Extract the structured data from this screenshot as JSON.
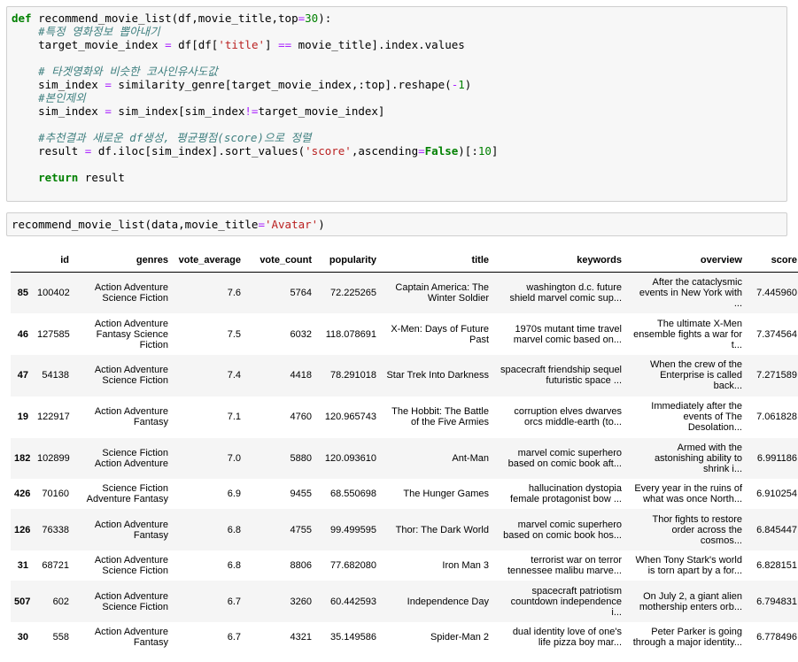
{
  "cell1": {
    "lines": [
      [
        {
          "t": "def",
          "c": "kw"
        },
        {
          "t": " recommend_movie_list(df,movie_title,top"
        },
        {
          "t": "=",
          "c": "op"
        },
        {
          "t": "30",
          "c": "num"
        },
        {
          "t": "):"
        }
      ],
      [
        {
          "t": "    "
        },
        {
          "t": "#특정 영화정보 뽑아내기",
          "c": "cm"
        }
      ],
      [
        {
          "t": "    target_movie_index "
        },
        {
          "t": "=",
          "c": "op"
        },
        {
          "t": " df[df["
        },
        {
          "t": "'title'",
          "c": "str"
        },
        {
          "t": "] "
        },
        {
          "t": "==",
          "c": "op"
        },
        {
          "t": " movie_title].index.values"
        }
      ],
      [
        {
          "t": ""
        }
      ],
      [
        {
          "t": "    "
        },
        {
          "t": "# 타겟영화와 비슷한 코사인유사도값",
          "c": "cm"
        }
      ],
      [
        {
          "t": "    sim_index "
        },
        {
          "t": "=",
          "c": "op"
        },
        {
          "t": " similarity_genre[target_movie_index,:top].reshape("
        },
        {
          "t": "-",
          "c": "op"
        },
        {
          "t": "1",
          "c": "num"
        },
        {
          "t": ")"
        }
      ],
      [
        {
          "t": "    "
        },
        {
          "t": "#본인제외",
          "c": "cm"
        }
      ],
      [
        {
          "t": "    sim_index "
        },
        {
          "t": "=",
          "c": "op"
        },
        {
          "t": " sim_index[sim_index"
        },
        {
          "t": "!=",
          "c": "op"
        },
        {
          "t": "target_movie_index]"
        }
      ],
      [
        {
          "t": ""
        }
      ],
      [
        {
          "t": "    "
        },
        {
          "t": "#추천결과 새로운 df생성, 평균평점(score)으로 정렬",
          "c": "cm"
        }
      ],
      [
        {
          "t": "    result "
        },
        {
          "t": "=",
          "c": "op"
        },
        {
          "t": " df.iloc[sim_index].sort_values("
        },
        {
          "t": "'score'",
          "c": "str"
        },
        {
          "t": ",ascending"
        },
        {
          "t": "=",
          "c": "op"
        },
        {
          "t": "False",
          "c": "kw"
        },
        {
          "t": ")[:"
        },
        {
          "t": "10",
          "c": "num"
        },
        {
          "t": "]"
        }
      ],
      [
        {
          "t": ""
        }
      ],
      [
        {
          "t": "    "
        },
        {
          "t": "return",
          "c": "kw"
        },
        {
          "t": " result"
        }
      ]
    ]
  },
  "cell2": {
    "lines": [
      [
        {
          "t": "recommend_movie_list(data,movie_title"
        },
        {
          "t": "=",
          "c": "op"
        },
        {
          "t": "'Avatar'",
          "c": "str"
        },
        {
          "t": ")"
        }
      ]
    ]
  },
  "table": {
    "columns": [
      "",
      "id",
      "genres",
      "vote_average",
      "vote_count",
      "popularity",
      "title",
      "keywords",
      "overview",
      "score"
    ],
    "rows": [
      {
        "idx": "85",
        "id": "100402",
        "genres": "Action Adventure\nScience Fiction",
        "vote_average": "7.6",
        "vote_count": "5764",
        "popularity": "72.225265",
        "title": "Captain America: The\nWinter Soldier",
        "keywords": "washington d.c. future\nshield marvel comic sup...",
        "overview": "After the cataclysmic\nevents in New York with\n...",
        "score": "7.445960"
      },
      {
        "idx": "46",
        "id": "127585",
        "genres": "Action Adventure\nFantasy Science\nFiction",
        "vote_average": "7.5",
        "vote_count": "6032",
        "popularity": "118.078691",
        "title": "X-Men: Days of Future\nPast",
        "keywords": "1970s mutant time travel\nmarvel comic based on...",
        "overview": "The ultimate X-Men\nensemble fights a war for\nt...",
        "score": "7.374564"
      },
      {
        "idx": "47",
        "id": "54138",
        "genres": "Action Adventure\nScience Fiction",
        "vote_average": "7.4",
        "vote_count": "4418",
        "popularity": "78.291018",
        "title": "Star Trek Into Darkness",
        "keywords": "spacecraft friendship sequel\nfuturistic space ...",
        "overview": "When the crew of the\nEnterprise is called\nback...",
        "score": "7.271589"
      },
      {
        "idx": "19",
        "id": "122917",
        "genres": "Action Adventure\nFantasy",
        "vote_average": "7.1",
        "vote_count": "4760",
        "popularity": "120.965743",
        "title": "The Hobbit: The Battle\nof the Five Armies",
        "keywords": "corruption elves dwarves\norcs middle-earth (to...",
        "overview": "Immediately after the\nevents of The\nDesolation...",
        "score": "7.061828"
      },
      {
        "idx": "182",
        "id": "102899",
        "genres": "Science Fiction\nAction Adventure",
        "vote_average": "7.0",
        "vote_count": "5880",
        "popularity": "120.093610",
        "title": "Ant-Man",
        "keywords": "marvel comic superhero\nbased on comic book aft...",
        "overview": "Armed with the\nastonishing ability to\nshrink i...",
        "score": "6.991186"
      },
      {
        "idx": "426",
        "id": "70160",
        "genres": "Science Fiction\nAdventure Fantasy",
        "vote_average": "6.9",
        "vote_count": "9455",
        "popularity": "68.550698",
        "title": "The Hunger Games",
        "keywords": "hallucination dystopia\nfemale protagonist bow ...",
        "overview": "Every year in the ruins of\nwhat was once North...",
        "score": "6.910254"
      },
      {
        "idx": "126",
        "id": "76338",
        "genres": "Action Adventure\nFantasy",
        "vote_average": "6.8",
        "vote_count": "4755",
        "popularity": "99.499595",
        "title": "Thor: The Dark World",
        "keywords": "marvel comic superhero\nbased on comic book hos...",
        "overview": "Thor fights to restore\norder across the\ncosmos...",
        "score": "6.845447"
      },
      {
        "idx": "31",
        "id": "68721",
        "genres": "Action Adventure\nScience Fiction",
        "vote_average": "6.8",
        "vote_count": "8806",
        "popularity": "77.682080",
        "title": "Iron Man 3",
        "keywords": "terrorist war on terror\ntennessee malibu marve...",
        "overview": "When Tony Stark's world\nis torn apart by a for...",
        "score": "6.828151"
      },
      {
        "idx": "507",
        "id": "602",
        "genres": "Action Adventure\nScience Fiction",
        "vote_average": "6.7",
        "vote_count": "3260",
        "popularity": "60.442593",
        "title": "Independence Day",
        "keywords": "spacecraft patriotism\ncountdown independence\ni...",
        "overview": "On July 2, a giant alien\nmothership enters orb...",
        "score": "6.794831"
      },
      {
        "idx": "30",
        "id": "558",
        "genres": "Action Adventure\nFantasy",
        "vote_average": "6.7",
        "vote_count": "4321",
        "popularity": "35.149586",
        "title": "Spider-Man 2",
        "keywords": "dual identity love of one's\nlife pizza boy mar...",
        "overview": "Peter Parker is going\nthrough a major identity...",
        "score": "6.778496"
      }
    ]
  }
}
